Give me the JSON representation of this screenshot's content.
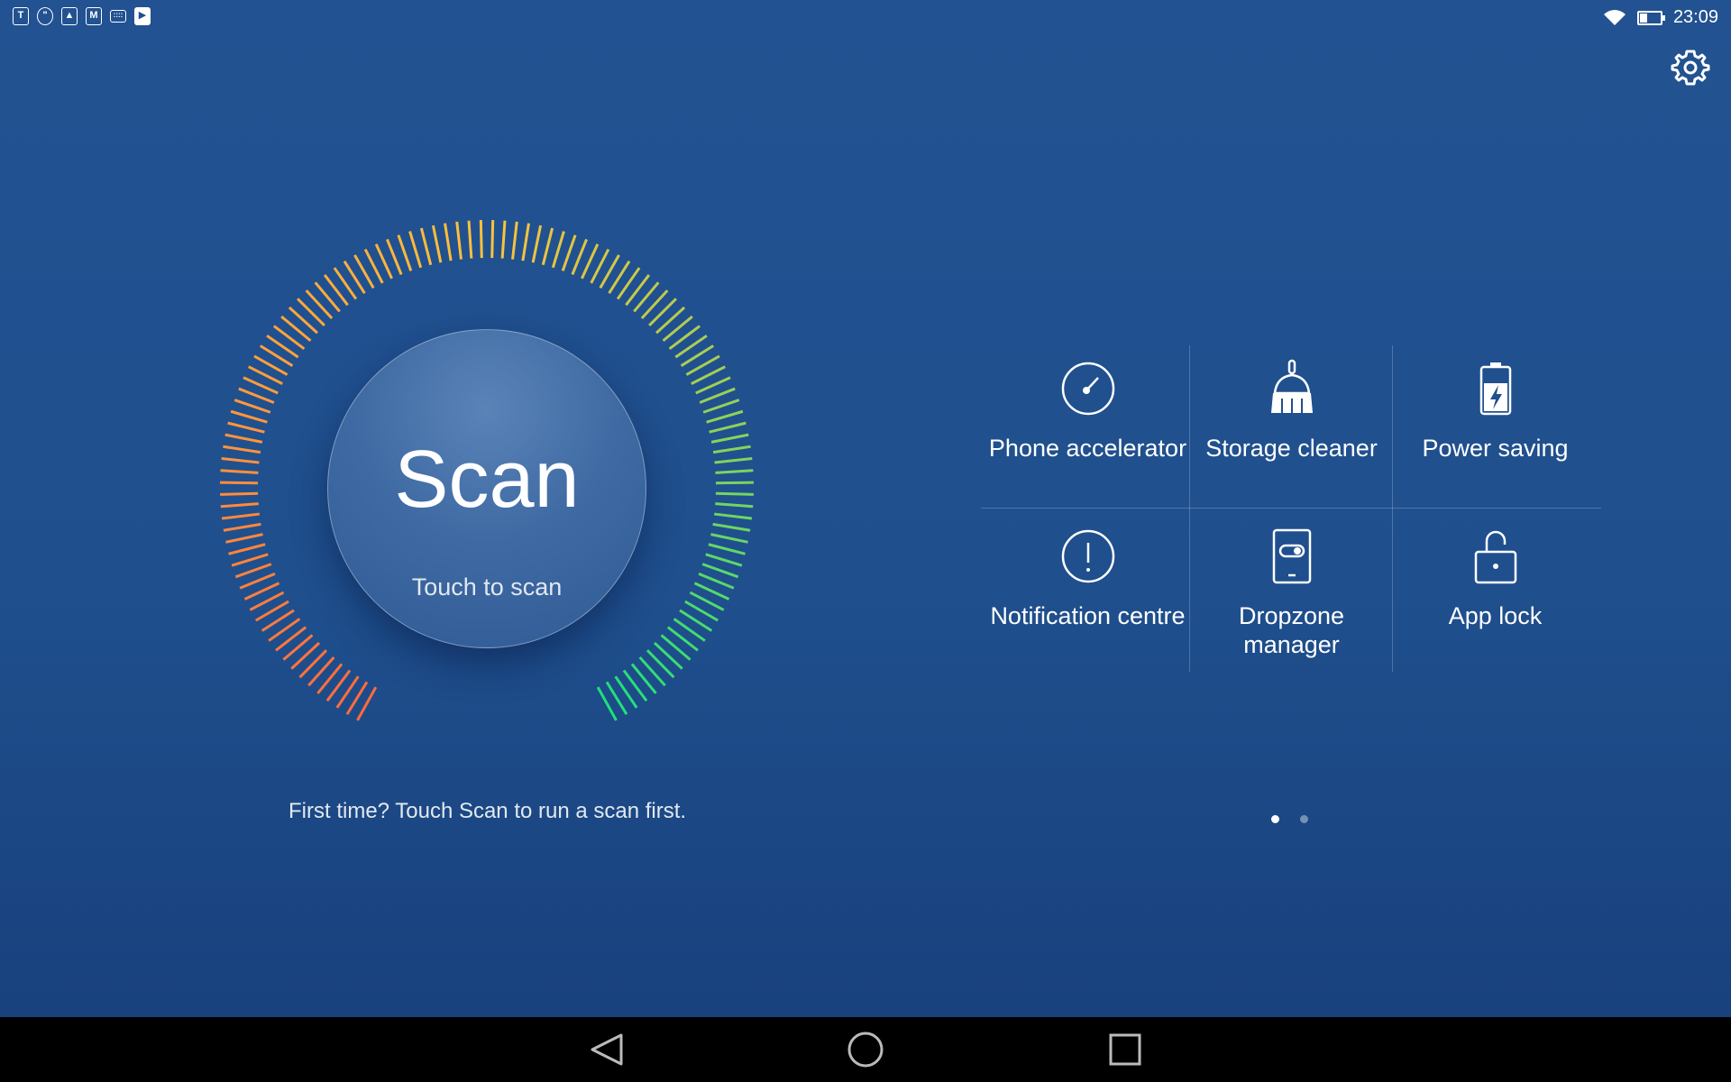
{
  "status_bar": {
    "left_icons": [
      "notification-t-icon",
      "hangouts-icon",
      "gallery-icon",
      "gmail-icon",
      "keyboard-icon",
      "store-icon"
    ],
    "time": "23:09",
    "battery_level": 0.35
  },
  "settings": {
    "icon": "gear-icon"
  },
  "scan": {
    "title": "Scan",
    "subtitle": "Touch to scan",
    "hint": "First time? Touch Scan to run a scan first."
  },
  "features": [
    {
      "label": "Phone accelerator",
      "icon": "speedometer-icon"
    },
    {
      "label": "Storage cleaner",
      "icon": "broom-icon"
    },
    {
      "label": "Power saving",
      "icon": "battery-bolt-icon"
    },
    {
      "label": "Notification centre",
      "icon": "alert-circle-icon"
    },
    {
      "label": "Dropzone manager",
      "icon": "phone-toggle-icon"
    },
    {
      "label": "App lock",
      "icon": "lock-icon"
    }
  ],
  "pager": {
    "pages": 2,
    "current": 1
  },
  "colors": {
    "background": "#225291",
    "gauge_low": "#ff6a3d",
    "gauge_mid": "#ffc23a",
    "gauge_high": "#1ee07a"
  },
  "nav": {
    "back": "back-icon",
    "home": "home-icon",
    "recents": "recents-icon"
  }
}
